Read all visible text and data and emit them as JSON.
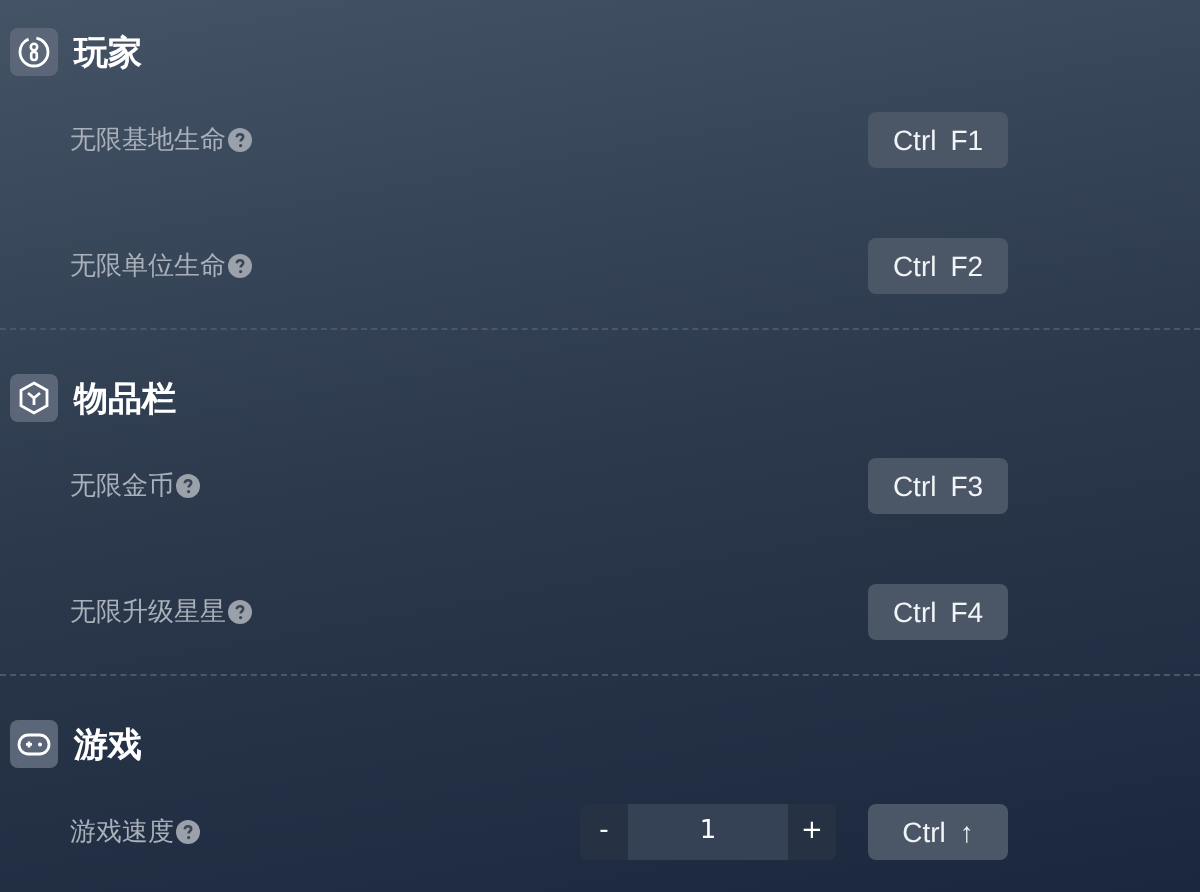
{
  "sections": [
    {
      "kind": "player",
      "title": "玩家",
      "rows": [
        {
          "kind": "hotkey",
          "label": "无限基地生命",
          "keys": [
            "Ctrl",
            "F1"
          ]
        },
        {
          "kind": "hotkey",
          "label": "无限单位生命",
          "keys": [
            "Ctrl",
            "F2"
          ]
        }
      ]
    },
    {
      "kind": "inventory",
      "title": "物品栏",
      "rows": [
        {
          "kind": "hotkey",
          "label": "无限金币",
          "keys": [
            "Ctrl",
            "F3"
          ]
        },
        {
          "kind": "hotkey",
          "label": "无限升级星星",
          "keys": [
            "Ctrl",
            "F4"
          ]
        }
      ]
    },
    {
      "kind": "game",
      "title": "游戏",
      "rows": [
        {
          "kind": "stepper",
          "label": "游戏速度",
          "minus": "-",
          "value": "1",
          "plus": "+",
          "keys": [
            "Ctrl",
            "↑"
          ]
        }
      ]
    }
  ]
}
